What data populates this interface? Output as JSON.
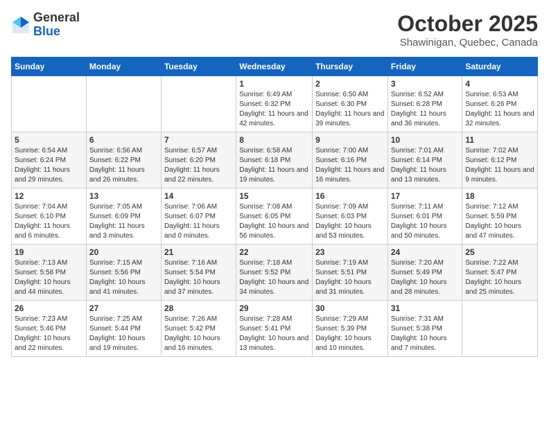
{
  "header": {
    "logo": {
      "general": "General",
      "blue": "Blue"
    },
    "title": "October 2025",
    "subtitle": "Shawinigan, Quebec, Canada"
  },
  "weekdays": [
    "Sunday",
    "Monday",
    "Tuesday",
    "Wednesday",
    "Thursday",
    "Friday",
    "Saturday"
  ],
  "weeks": [
    [
      {
        "day": "",
        "info": ""
      },
      {
        "day": "",
        "info": ""
      },
      {
        "day": "",
        "info": ""
      },
      {
        "day": "1",
        "info": "Sunrise: 6:49 AM\nSunset: 6:32 PM\nDaylight: 11 hours\nand 42 minutes."
      },
      {
        "day": "2",
        "info": "Sunrise: 6:50 AM\nSunset: 6:30 PM\nDaylight: 11 hours\nand 39 minutes."
      },
      {
        "day": "3",
        "info": "Sunrise: 6:52 AM\nSunset: 6:28 PM\nDaylight: 11 hours\nand 36 minutes."
      },
      {
        "day": "4",
        "info": "Sunrise: 6:53 AM\nSunset: 6:26 PM\nDaylight: 11 hours\nand 32 minutes."
      }
    ],
    [
      {
        "day": "5",
        "info": "Sunrise: 6:54 AM\nSunset: 6:24 PM\nDaylight: 11 hours\nand 29 minutes."
      },
      {
        "day": "6",
        "info": "Sunrise: 6:56 AM\nSunset: 6:22 PM\nDaylight: 11 hours\nand 26 minutes."
      },
      {
        "day": "7",
        "info": "Sunrise: 6:57 AM\nSunset: 6:20 PM\nDaylight: 11 hours\nand 22 minutes."
      },
      {
        "day": "8",
        "info": "Sunrise: 6:58 AM\nSunset: 6:18 PM\nDaylight: 11 hours\nand 19 minutes."
      },
      {
        "day": "9",
        "info": "Sunrise: 7:00 AM\nSunset: 6:16 PM\nDaylight: 11 hours\nand 16 minutes."
      },
      {
        "day": "10",
        "info": "Sunrise: 7:01 AM\nSunset: 6:14 PM\nDaylight: 11 hours\nand 13 minutes."
      },
      {
        "day": "11",
        "info": "Sunrise: 7:02 AM\nSunset: 6:12 PM\nDaylight: 11 hours\nand 9 minutes."
      }
    ],
    [
      {
        "day": "12",
        "info": "Sunrise: 7:04 AM\nSunset: 6:10 PM\nDaylight: 11 hours\nand 6 minutes."
      },
      {
        "day": "13",
        "info": "Sunrise: 7:05 AM\nSunset: 6:09 PM\nDaylight: 11 hours\nand 3 minutes."
      },
      {
        "day": "14",
        "info": "Sunrise: 7:06 AM\nSunset: 6:07 PM\nDaylight: 11 hours\nand 0 minutes."
      },
      {
        "day": "15",
        "info": "Sunrise: 7:08 AM\nSunset: 6:05 PM\nDaylight: 10 hours\nand 56 minutes."
      },
      {
        "day": "16",
        "info": "Sunrise: 7:09 AM\nSunset: 6:03 PM\nDaylight: 10 hours\nand 53 minutes."
      },
      {
        "day": "17",
        "info": "Sunrise: 7:11 AM\nSunset: 6:01 PM\nDaylight: 10 hours\nand 50 minutes."
      },
      {
        "day": "18",
        "info": "Sunrise: 7:12 AM\nSunset: 5:59 PM\nDaylight: 10 hours\nand 47 minutes."
      }
    ],
    [
      {
        "day": "19",
        "info": "Sunrise: 7:13 AM\nSunset: 5:58 PM\nDaylight: 10 hours\nand 44 minutes."
      },
      {
        "day": "20",
        "info": "Sunrise: 7:15 AM\nSunset: 5:56 PM\nDaylight: 10 hours\nand 41 minutes."
      },
      {
        "day": "21",
        "info": "Sunrise: 7:16 AM\nSunset: 5:54 PM\nDaylight: 10 hours\nand 37 minutes."
      },
      {
        "day": "22",
        "info": "Sunrise: 7:18 AM\nSunset: 5:52 PM\nDaylight: 10 hours\nand 34 minutes."
      },
      {
        "day": "23",
        "info": "Sunrise: 7:19 AM\nSunset: 5:51 PM\nDaylight: 10 hours\nand 31 minutes."
      },
      {
        "day": "24",
        "info": "Sunrise: 7:20 AM\nSunset: 5:49 PM\nDaylight: 10 hours\nand 28 minutes."
      },
      {
        "day": "25",
        "info": "Sunrise: 7:22 AM\nSunset: 5:47 PM\nDaylight: 10 hours\nand 25 minutes."
      }
    ],
    [
      {
        "day": "26",
        "info": "Sunrise: 7:23 AM\nSunset: 5:46 PM\nDaylight: 10 hours\nand 22 minutes."
      },
      {
        "day": "27",
        "info": "Sunrise: 7:25 AM\nSunset: 5:44 PM\nDaylight: 10 hours\nand 19 minutes."
      },
      {
        "day": "28",
        "info": "Sunrise: 7:26 AM\nSunset: 5:42 PM\nDaylight: 10 hours\nand 16 minutes."
      },
      {
        "day": "29",
        "info": "Sunrise: 7:28 AM\nSunset: 5:41 PM\nDaylight: 10 hours\nand 13 minutes."
      },
      {
        "day": "30",
        "info": "Sunrise: 7:29 AM\nSunset: 5:39 PM\nDaylight: 10 hours\nand 10 minutes."
      },
      {
        "day": "31",
        "info": "Sunrise: 7:31 AM\nSunset: 5:38 PM\nDaylight: 10 hours\nand 7 minutes."
      },
      {
        "day": "",
        "info": ""
      }
    ]
  ]
}
